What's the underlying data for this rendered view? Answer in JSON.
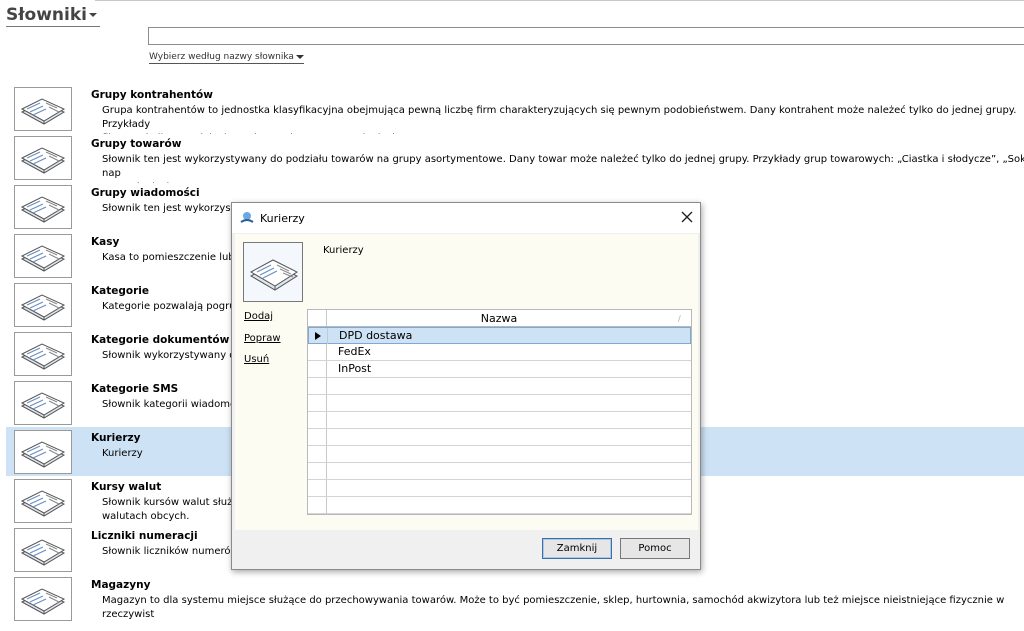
{
  "header": {
    "title": "Słowniki"
  },
  "search": {
    "value": "",
    "placeholder": ""
  },
  "filter": {
    "label": "Wybierz według nazwy słownika"
  },
  "dictionaries": [
    {
      "name": "Grupy kontrahentów",
      "description": "Grupa kontrahentów to jednostka klasyfikacyjna obejmująca pewną liczbę firm charakteryzujących się pewnym podobieństwem. Dany kontrahent może należeć tylko do jednej grupy. Przykłady\nfiltrowania list oraz jako kryterium wyboru w zestawieniach."
    },
    {
      "name": "Grupy towarów",
      "description": "Słownik ten jest wykorzystywany do podziału towarów na grupy asortymentowe. Dany towar może należeć tylko do jednej grupy. Przykłady grup towarowych: „Ciastka i słodycze”, „Soki i nap\nzestawieniach."
    },
    {
      "name": "Grupy wiadomości",
      "description": "Słownik ten jest wykorzystywany                                                                                                            y może odbywać się automatycznie poprzez zdefiniowane reguły w"
    },
    {
      "name": "Kasy",
      "description": "Kasa to pomieszczenie lub                                                                                                                          pogrupować dokumenty finansowe KP i KW na odrębne zbiory. Un"
    },
    {
      "name": "Kategorie",
      "description": "Kategorie pozwalają pogru                                                                                                                          wem. Kategorie dokumentów są wykorzystywane jako kryterium wyb"
    },
    {
      "name": "Kategorie dokumentów w bi",
      "description": "Słownik wykorzystywany d"
    },
    {
      "name": "Kategorie SMS",
      "description": "Słownik kategorii wiadomo"
    },
    {
      "name": "Kurierzy",
      "description": "Kurierzy",
      "selected": true
    },
    {
      "name": "Kursy walut",
      "description": "Słownik kursów walut służ                                                                                                                          tabelę kursów). Tabele kursów walut zawierają kursy aktywnych wa\nwalutach obcych."
    },
    {
      "name": "Liczniki numeracji",
      "description": "Słownik liczników numerów                                                                                                                         w kasowych oraz płatności kartą przy sprzedaży."
    },
    {
      "name": "Magazyny",
      "description": "Magazyn to dla systemu miejsce służące do przechowywania towarów. Może to być pomieszczenie, sklep, hurtownia, samochód akwizytora lub też miejsce nieistniejące fizycznie w rzeczywist"
    }
  ],
  "dialog": {
    "title": "Kurierzy",
    "header": "Kurierzy",
    "actions": {
      "add": "Dodaj",
      "edit": "Popraw",
      "delete": "Usuń"
    },
    "grid": {
      "column": "Nazwa",
      "rows": [
        "DPD dostawa",
        "FedEx",
        "InPost"
      ],
      "selected_index": 0
    },
    "buttons": {
      "close": "Zamknij",
      "help": "Pomoc"
    }
  },
  "colors": {
    "selection": "#cde2f5",
    "dialog_body": "#fdfcf3",
    "accent": "#3c6ea8"
  },
  "icons": {
    "dictionary": "book-icon",
    "close": "close-icon",
    "app": "app-logo-icon",
    "row": "current-row-arrow-icon"
  }
}
